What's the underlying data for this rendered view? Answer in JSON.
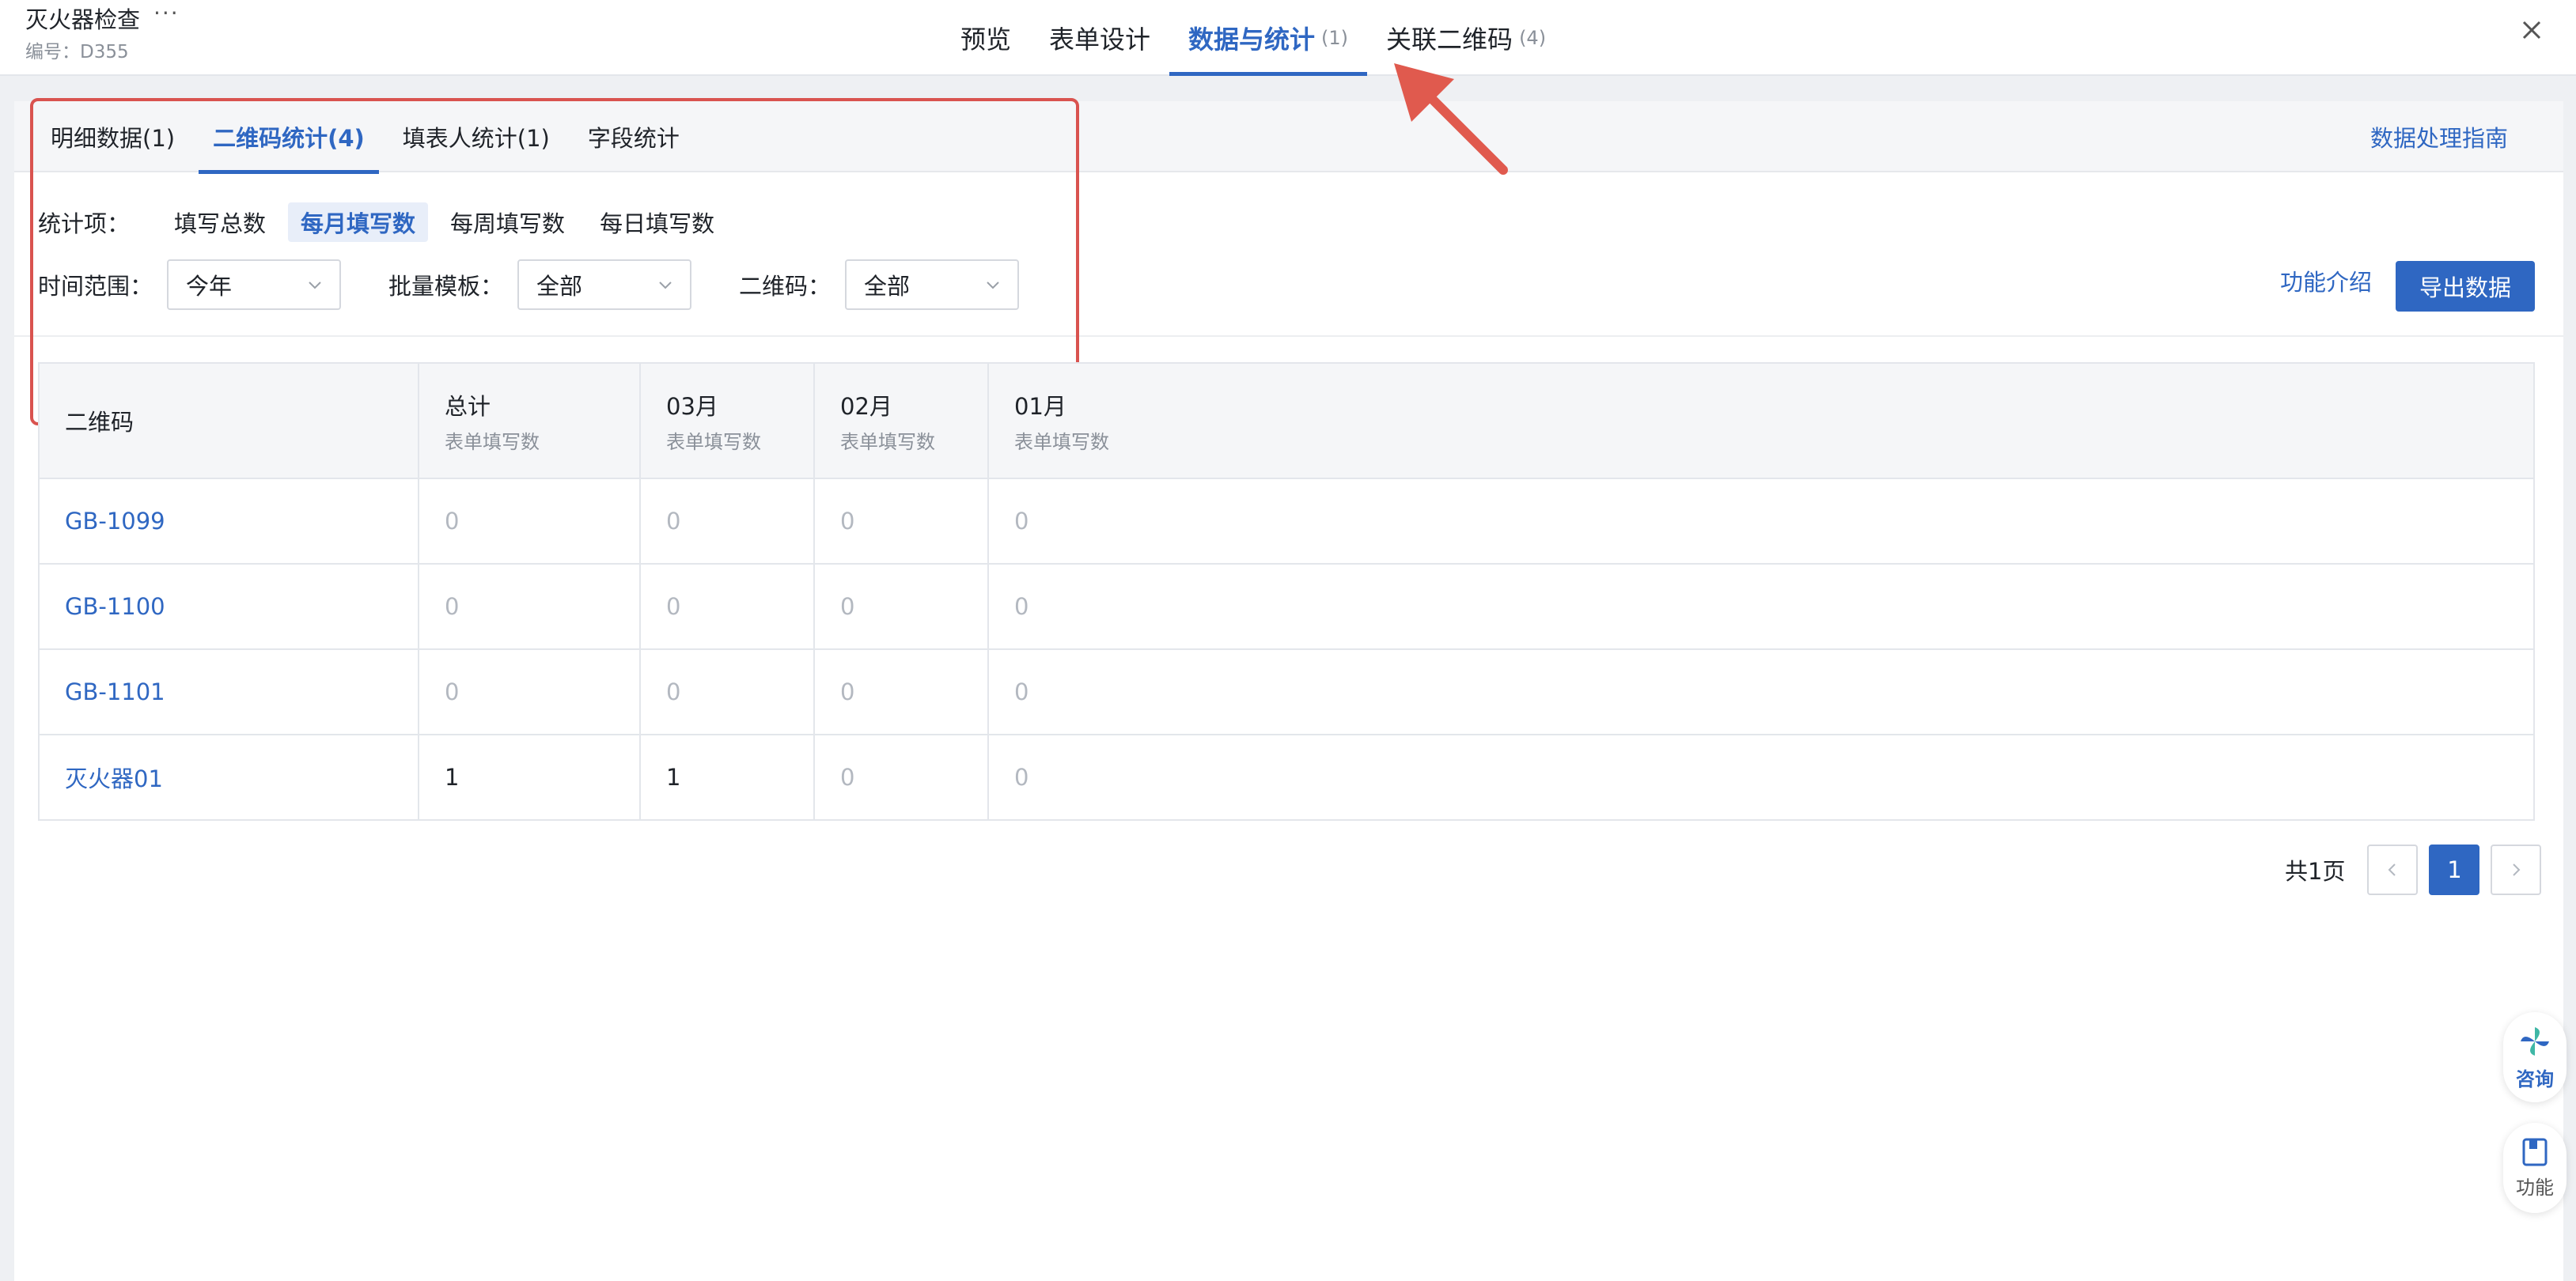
{
  "header": {
    "title": "灭火器检查",
    "more": "···",
    "code": "编号：D355",
    "tabs": [
      {
        "label": "预览",
        "count": ""
      },
      {
        "label": "表单设计",
        "count": ""
      },
      {
        "label": "数据与统计",
        "count": "(1)"
      },
      {
        "label": "关联二维码",
        "count": "(4)"
      }
    ]
  },
  "subtabs": [
    {
      "label": "明细数据(1)"
    },
    {
      "label": "二维码统计(4)"
    },
    {
      "label": "填表人统计(1)"
    },
    {
      "label": "字段统计"
    }
  ],
  "guide_link": "数据处理指南",
  "filters": {
    "stat_label": "统计项：",
    "stat_options": [
      "填写总数",
      "每月填写数",
      "每周填写数",
      "每日填写数"
    ],
    "stat_selected": "每月填写数",
    "time_label": "时间范围：",
    "time_value": "今年",
    "batch_label": "批量模板：",
    "batch_value": "全部",
    "qr_label": "二维码：",
    "qr_value": "全部"
  },
  "intro_link": "功能介绍",
  "export_label": "导出数据",
  "table": {
    "columns": [
      {
        "title": "二维码",
        "sub": ""
      },
      {
        "title": "总计",
        "sub": "表单填写数"
      },
      {
        "title": "03月",
        "sub": "表单填写数"
      },
      {
        "title": "02月",
        "sub": "表单填写数"
      },
      {
        "title": "01月",
        "sub": "表单填写数"
      }
    ],
    "rows": [
      {
        "code": "GB-1099",
        "total": "0",
        "m03": "0",
        "m02": "0",
        "m01": "0"
      },
      {
        "code": "GB-1100",
        "total": "0",
        "m03": "0",
        "m02": "0",
        "m01": "0"
      },
      {
        "code": "GB-1101",
        "total": "0",
        "m03": "0",
        "m02": "0",
        "m01": "0"
      },
      {
        "code": "灭火器01",
        "total": "1",
        "m03": "1",
        "m02": "0",
        "m01": "0"
      }
    ]
  },
  "pagination": {
    "total_text": "共1页",
    "current": "1"
  },
  "floating": {
    "consult": "咨询",
    "func": "功能"
  },
  "colors": {
    "accent": "#2f67c2",
    "annotation": "#d9534f"
  }
}
